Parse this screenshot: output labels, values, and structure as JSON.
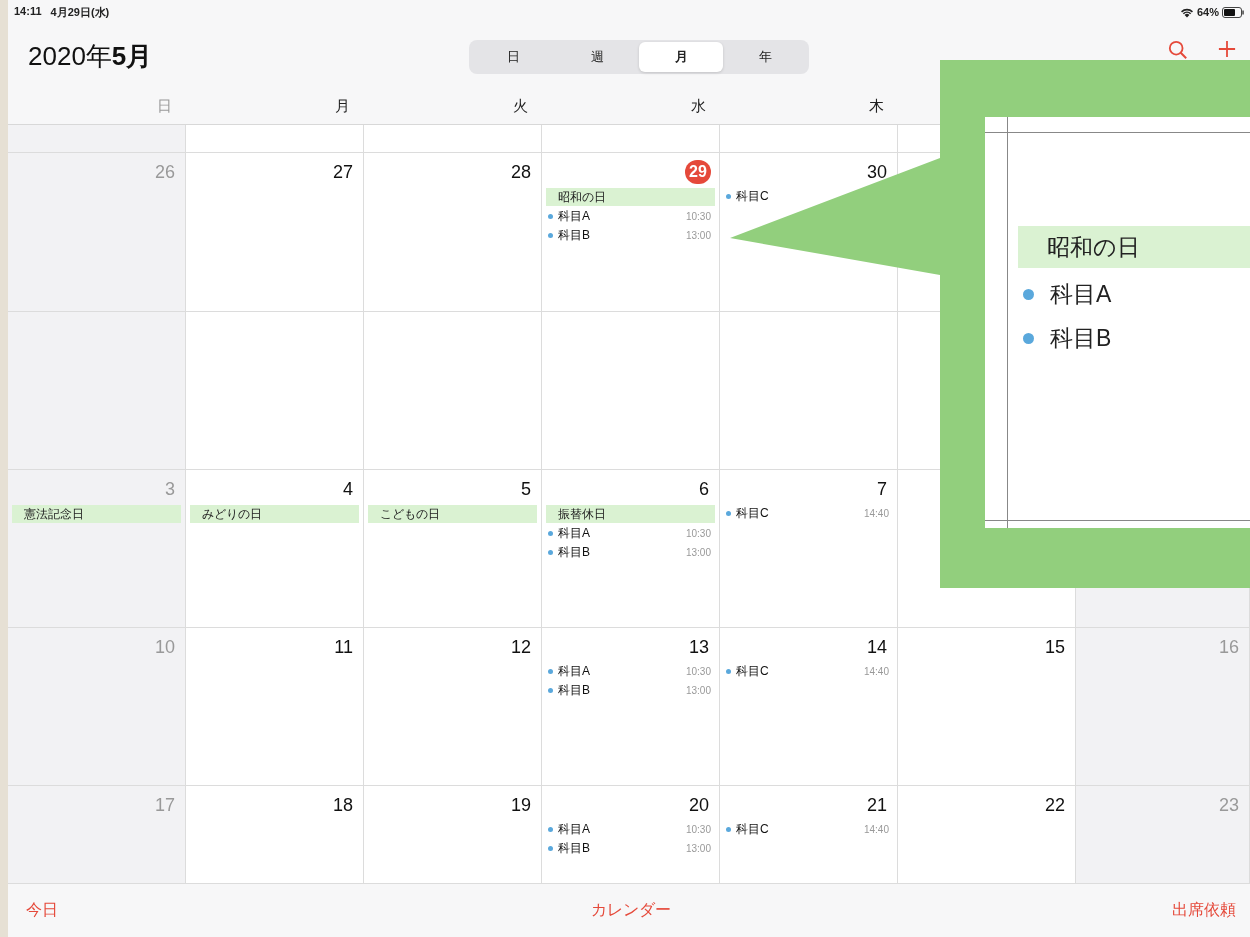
{
  "status_bar": {
    "time": "14:11",
    "date": "4月29日(水)",
    "battery": "64%"
  },
  "header": {
    "title": "2020年**5月**",
    "views": [
      {
        "label": "日",
        "selected": false
      },
      {
        "label": "週",
        "selected": false
      },
      {
        "label": "月",
        "selected": true
      },
      {
        "label": "年",
        "selected": false
      }
    ]
  },
  "weekdays": [
    "日",
    "月",
    "火",
    "水",
    "木"
  ],
  "weeks": [
    {
      "days": [
        {
          "date": "26",
          "today": false
        },
        {
          "date": "27",
          "today": false
        },
        {
          "date": "28",
          "today": false
        },
        {
          "date": "29",
          "today": true,
          "events": [
            {
              "kind": "holiday",
              "title": "昭和の日"
            },
            {
              "kind": "timed",
              "title": "科目A",
              "time": "10:30"
            },
            {
              "kind": "timed",
              "title": "科目B",
              "time": "13:00"
            }
          ]
        },
        {
          "date": "30",
          "today": false,
          "events": [
            {
              "kind": "timed",
              "title": "科目C"
            }
          ]
        }
      ]
    },
    {
      "kind": "blank"
    },
    {
      "days": [
        {
          "date": "3",
          "today": false,
          "events": [
            {
              "kind": "holiday",
              "title": "憲法記念日"
            }
          ]
        },
        {
          "date": "4",
          "today": false,
          "events": [
            {
              "kind": "holiday",
              "title": "みどりの日"
            }
          ]
        },
        {
          "date": "5",
          "today": false,
          "events": [
            {
              "kind": "holiday",
              "title": "こどもの日"
            }
          ]
        },
        {
          "date": "6",
          "today": false,
          "events": [
            {
              "kind": "holiday",
              "title": "振替休日"
            },
            {
              "kind": "timed",
              "title": "科目A",
              "time": "10:30"
            },
            {
              "kind": "timed",
              "title": "科目B",
              "time": "13:00"
            }
          ]
        },
        {
          "date": "7",
          "today": false,
          "events": [
            {
              "kind": "timed",
              "title": "科目C",
              "time": "14:40"
            }
          ]
        }
      ]
    },
    {
      "days": [
        {
          "date": "10",
          "today": false
        },
        {
          "date": "11",
          "today": false
        },
        {
          "date": "12",
          "today": false
        },
        {
          "date": "13",
          "today": false,
          "events": [
            {
              "kind": "timed",
              "title": "科目A",
              "time": "10:30"
            },
            {
              "kind": "timed",
              "title": "科目B",
              "time": "13:00"
            }
          ]
        },
        {
          "date": "14",
          "today": false,
          "events": [
            {
              "kind": "timed",
              "title": "科目C",
              "time": "14:40"
            }
          ]
        },
        {
          "date": "15",
          "today": false
        },
        {
          "date": "16",
          "today": false
        }
      ]
    },
    {
      "days": [
        {
          "date": "17",
          "today": false
        },
        {
          "date": "18",
          "today": false
        },
        {
          "date": "19",
          "today": false
        },
        {
          "date": "20",
          "today": false,
          "events": [
            {
              "kind": "timed",
              "title": "科目A",
              "time": "10:30"
            },
            {
              "kind": "timed",
              "title": "科目B",
              "time": "13:00"
            }
          ]
        },
        {
          "date": "21",
          "today": false,
          "events": [
            {
              "kind": "timed",
              "title": "科目C",
              "time": "14:40"
            }
          ]
        },
        {
          "date": "22",
          "today": false
        },
        {
          "date": "23",
          "today": false
        }
      ]
    }
  ],
  "toolbar": {
    "today": "今日",
    "calendars": "カレンダー",
    "inbox": "出席依頼"
  },
  "callout": {
    "events": [
      {
        "kind": "holiday",
        "title": "昭和の日"
      },
      {
        "kind": "timed",
        "title": "科目A"
      },
      {
        "kind": "timed",
        "title": "科目B"
      }
    ]
  }
}
